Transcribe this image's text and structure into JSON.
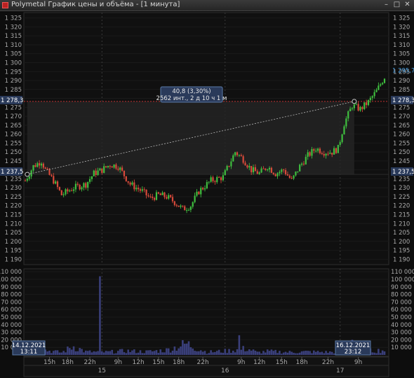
{
  "window": {
    "title": "Polymetal График цены и объёма - [1 минута]",
    "minimize_glyph": "–",
    "maximize_glyph": "□",
    "close_glyph": "✕"
  },
  "colors": {
    "background": "#0d0d0d",
    "up_candle": "#3fbf3f",
    "down_candle": "#d84a3a",
    "volume": "#3a3f7a",
    "last_price": "#4a9fe0",
    "marker_bg": "#2a3a5a",
    "level_line": "#c03030"
  },
  "price_axis": {
    "ticks": [
      "1 325",
      "1 320",
      "1 315",
      "1 310",
      "1 305",
      "1 300",
      "1 295",
      "1 290",
      "1 285",
      "1 280",
      "1 275",
      "1 270",
      "1 265",
      "1 260",
      "1 255",
      "1 250",
      "1 245",
      "1 240",
      "1 235",
      "1 230",
      "1 225",
      "1 220",
      "1 215",
      "1 210",
      "1 205",
      "1 200",
      "1 195",
      "1 190"
    ],
    "range": [
      1187,
      1328
    ]
  },
  "volume_axis": {
    "ticks": [
      "110 000",
      "100 000",
      "90 000",
      "80 000",
      "70 000",
      "60 000",
      "50 000",
      "40 000",
      "30 000",
      "20 000",
      "10 000"
    ],
    "range": [
      0,
      112000
    ]
  },
  "labels": {
    "level_upper": "1 278,3",
    "level_lower": "1 237,5",
    "last_price": "1 295,7",
    "measure_line1": "40,8 (3,30%)",
    "measure_line2": "2562 инт., 2 д 10 ч 1 м",
    "start_date": "14.12.2021",
    "start_time": "13:11",
    "end_date": "16.12.2021",
    "end_time": "23:12"
  },
  "time_axis": {
    "hours": [
      "15h",
      "18h",
      "22h",
      "9h",
      "12h",
      "15h",
      "18h",
      "22h",
      "9h",
      "12h",
      "15h",
      "18h",
      "22h",
      "9h"
    ],
    "days": [
      "15",
      "16",
      "17"
    ]
  },
  "chart_data": {
    "type": "candlestick",
    "x_unit": "1-minute bars",
    "price_path": [
      [
        0,
        1234
      ],
      [
        4,
        1242
      ],
      [
        8,
        1245
      ],
      [
        10,
        1240
      ],
      [
        14,
        1234
      ],
      [
        18,
        1226
      ],
      [
        24,
        1230
      ],
      [
        30,
        1232
      ],
      [
        34,
        1238
      ],
      [
        38,
        1240
      ],
      [
        42,
        1243
      ],
      [
        46,
        1242
      ],
      [
        52,
        1232
      ],
      [
        58,
        1228
      ],
      [
        62,
        1224
      ],
      [
        66,
        1226
      ],
      [
        70,
        1225
      ],
      [
        74,
        1222
      ],
      [
        78,
        1218
      ],
      [
        82,
        1220
      ],
      [
        86,
        1228
      ],
      [
        92,
        1234
      ],
      [
        98,
        1236
      ],
      [
        104,
        1250
      ],
      [
        108,
        1246
      ],
      [
        112,
        1240
      ],
      [
        116,
        1238
      ],
      [
        120,
        1242
      ],
      [
        124,
        1238
      ],
      [
        128,
        1240
      ],
      [
        132,
        1234
      ],
      [
        136,
        1242
      ],
      [
        140,
        1248
      ],
      [
        144,
        1252
      ],
      [
        148,
        1250
      ],
      [
        152,
        1250
      ],
      [
        155,
        1252
      ],
      [
        158,
        1266
      ],
      [
        162,
        1276
      ],
      [
        166,
        1274
      ],
      [
        170,
        1278
      ],
      [
        174,
        1284
      ],
      [
        178,
        1292
      ]
    ],
    "volume_path": [
      [
        0,
        4000
      ],
      [
        6,
        3500
      ],
      [
        10,
        6000
      ],
      [
        18,
        3000
      ],
      [
        24,
        11000
      ],
      [
        30,
        4000
      ],
      [
        40,
        3500
      ],
      [
        50,
        5000
      ],
      [
        60,
        4000
      ],
      [
        70,
        6000
      ],
      [
        80,
        14000
      ],
      [
        90,
        3500
      ],
      [
        100,
        5000
      ],
      [
        110,
        8000
      ],
      [
        115,
        3000
      ],
      [
        120,
        4500
      ],
      [
        130,
        3500
      ],
      [
        140,
        4000
      ],
      [
        150,
        3500
      ],
      [
        160,
        4000
      ],
      [
        170,
        5000
      ],
      [
        178,
        6000
      ]
    ],
    "volume_spikes": [
      {
        "at": 37,
        "value": 104000
      },
      {
        "at": 106,
        "value": 26000
      },
      {
        "at": 162,
        "value": 20000
      }
    ],
    "measurement": {
      "from": 1237.5,
      "to": 1278.3,
      "change": 40.8,
      "percent": 3.3,
      "intervals": 2562
    },
    "ylim_price": [
      1187,
      1328
    ],
    "ylim_volume": [
      0,
      112000
    ]
  }
}
